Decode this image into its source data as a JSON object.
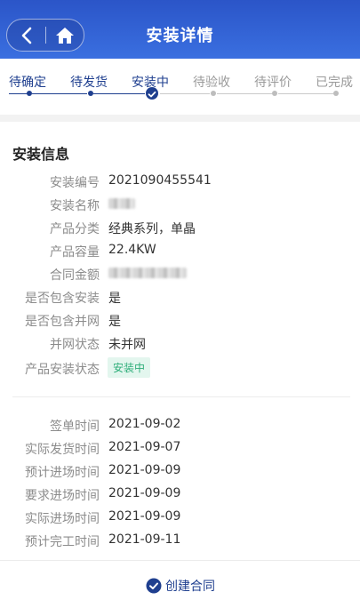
{
  "header": {
    "title": "安装详情"
  },
  "steps": [
    {
      "label": "待确定",
      "state": "done"
    },
    {
      "label": "待发货",
      "state": "done"
    },
    {
      "label": "安装中",
      "state": "current"
    },
    {
      "label": "待验收",
      "state": "todo"
    },
    {
      "label": "待评价",
      "state": "todo"
    },
    {
      "label": "已完成",
      "state": "todo"
    }
  ],
  "install_info": {
    "title": "安装信息",
    "rows": [
      {
        "label": "安装编号",
        "value": "2021090455541"
      },
      {
        "label": "安装名称",
        "value": ""
      },
      {
        "label": "产品分类",
        "value": "经典系列，单晶"
      },
      {
        "label": "产品容量",
        "value": "22.4KW"
      },
      {
        "label": "合同金额",
        "value": ""
      },
      {
        "label": "是否包含安装",
        "value": "是"
      },
      {
        "label": "是否包含并网",
        "value": "是"
      },
      {
        "label": "并网状态",
        "value": "未并网"
      },
      {
        "label": "产品安装状态",
        "value": "安装中"
      }
    ]
  },
  "dates": [
    {
      "label": "签单时间",
      "value": "2021-09-02"
    },
    {
      "label": "实际发货时间",
      "value": "2021-09-07"
    },
    {
      "label": "预计进场时间",
      "value": "2021-09-09"
    },
    {
      "label": "要求进场时间",
      "value": "2021-09-09"
    },
    {
      "label": "实际进场时间",
      "value": "2021-09-09"
    },
    {
      "label": "预计完工时间",
      "value": "2021-09-11"
    }
  ],
  "footer": {
    "create_label": "创建合同"
  },
  "colors": {
    "header": "#2b55c8",
    "accent": "#1f3f8f",
    "status_green": "#2fae7a"
  }
}
